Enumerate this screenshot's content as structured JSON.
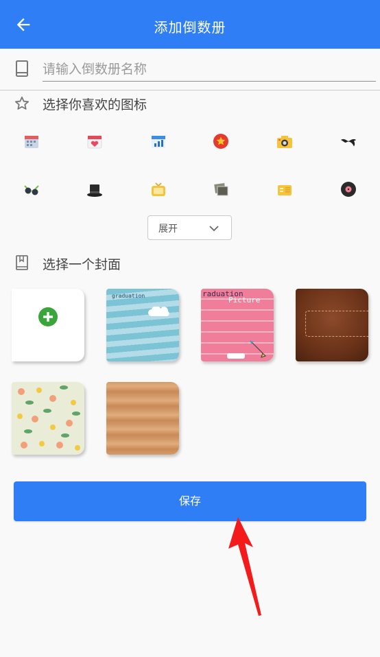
{
  "appbar": {
    "title": "添加倒数册",
    "back_icon": "arrow-left-icon"
  },
  "name_field": {
    "placeholder": "请输入倒数册名称",
    "value": "",
    "icon": "book-icon"
  },
  "icon_section": {
    "title": "选择你喜欢的图标",
    "icon": "star-outline-icon",
    "icons": [
      "calendar-icon",
      "heart-calendar-icon",
      "chart-calendar-icon",
      "star-badge-icon",
      "camera-icon",
      "mustache-icon",
      "sunglasses-icon",
      "top-hat-icon",
      "tv-icon",
      "photos-icon",
      "radio-icon",
      "vinyl-record-icon"
    ],
    "expand_label": "展开"
  },
  "cover_section": {
    "title": "选择一个封面",
    "icon": "bookmark-book-icon",
    "covers": [
      {
        "kind": "add",
        "icon": "plus-circle-icon"
      },
      {
        "kind": "stripes",
        "caption": "graduation"
      },
      {
        "kind": "pink",
        "caption": "raduation",
        "caption2": "Picture"
      },
      {
        "kind": "leather"
      },
      {
        "kind": "floral"
      },
      {
        "kind": "wood"
      }
    ]
  },
  "save_label": "保存",
  "colors": {
    "primary": "#2f7ef5",
    "background": "#f9f9f9",
    "annotation_arrow": "#f31b1b"
  }
}
